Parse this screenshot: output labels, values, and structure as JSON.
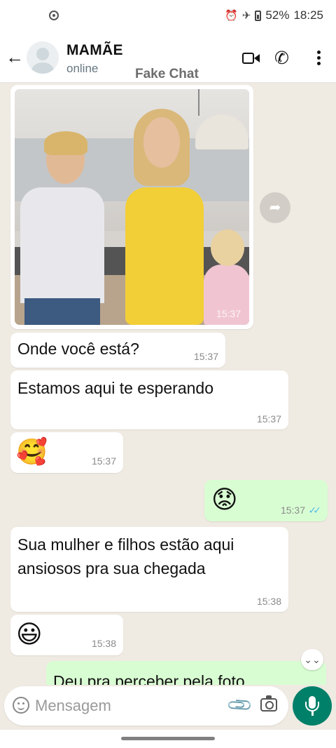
{
  "status_bar": {
    "battery": "52%",
    "time": "18:25",
    "icons": [
      "alarm-icon",
      "airplane-mode-icon",
      "battery-icon"
    ]
  },
  "header": {
    "contact_name": "MAMÃE",
    "contact_status": "online",
    "watermark": "Fake Chat",
    "icons": [
      "back-arrow-icon",
      "video-call-icon",
      "phone-icon",
      "more-vert-icon"
    ]
  },
  "messages": [
    {
      "type": "image",
      "direction": "in",
      "time": "15:37"
    },
    {
      "type": "text",
      "direction": "in",
      "text": "Onde você está?",
      "time": "15:37"
    },
    {
      "type": "text",
      "direction": "in",
      "text": "Estamos aqui te esperando",
      "time": "15:37"
    },
    {
      "type": "emoji",
      "direction": "in",
      "text": "🥰",
      "time": "15:37"
    },
    {
      "type": "emoji",
      "direction": "out",
      "text": "😟",
      "time": "15:37",
      "status": "read"
    },
    {
      "type": "text",
      "direction": "in",
      "text_lines": [
        "Sua mulher e filhos estão aqui",
        "ansiosos pra sua chegada"
      ],
      "time": "15:38"
    },
    {
      "type": "emoji",
      "direction": "in",
      "text": "😃",
      "time": "15:38"
    },
    {
      "type": "text",
      "direction": "out",
      "text": "Deu pra perceber pela foto"
    }
  ],
  "composer": {
    "placeholder": "Mensagem",
    "icons": [
      "emoji-icon",
      "attach-icon",
      "camera-icon",
      "mic-icon"
    ]
  },
  "colors": {
    "chat_background": "#efeae2",
    "outgoing_bubble": "#d9fdd3",
    "incoming_bubble": "#ffffff",
    "accent": "#008069",
    "read_ticks": "#53bdeb"
  }
}
